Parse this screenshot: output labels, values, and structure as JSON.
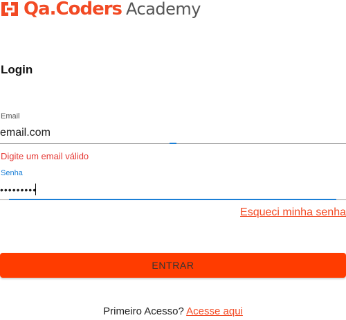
{
  "brand": {
    "name": "Qa.Coders",
    "suffix": "Academy",
    "logo_icon": "qa-coders-logo-icon",
    "accent_color": "#f24a24"
  },
  "form": {
    "title": "Login",
    "email": {
      "label": "Email",
      "value": "email.com",
      "error": "Digite um email válido"
    },
    "password": {
      "label": "Senha",
      "value": "•••••••••"
    },
    "forgot_link": "Esqueci minha senha",
    "submit_label": "ENTRAR",
    "submit_color": "#ff3c00"
  },
  "footer": {
    "prompt": "Primeiro Acesso?",
    "link": "Acesse aqui"
  }
}
